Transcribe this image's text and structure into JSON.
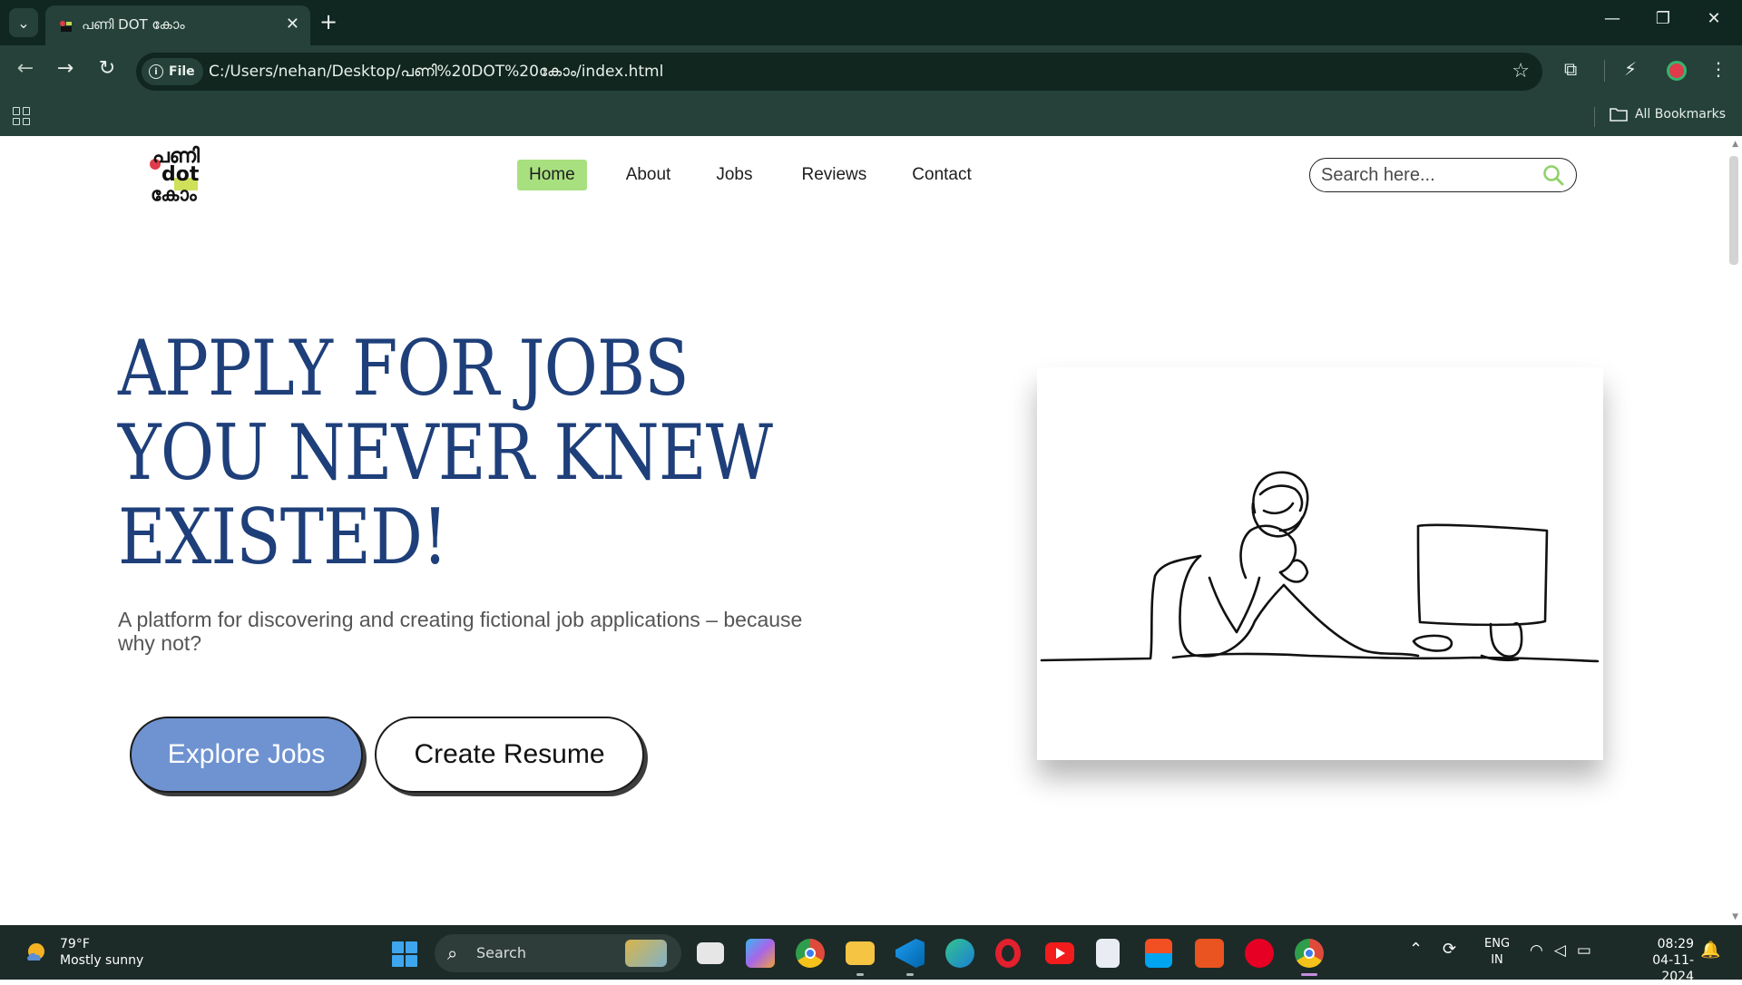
{
  "browser": {
    "tab_title": "പണി DOT കോം",
    "tab_close": "✕",
    "new_tab": "+",
    "window_controls": {
      "minimize": "—",
      "restore": "❐",
      "close": "✕"
    },
    "site_chip": "File",
    "url": "C:/Users/nehan/Desktop/പണി%20DOT%20കോം/index.html",
    "bookmarks_label": "All Bookmarks",
    "icons": [
      "tab-search-icon",
      "back-icon",
      "forward-icon",
      "reload-icon",
      "info-icon",
      "star-icon",
      "extensions-icon",
      "performance-icon",
      "profile-icon",
      "menu-icon",
      "apps-icon",
      "folder-icon"
    ]
  },
  "site": {
    "logo": {
      "line1": "പണി",
      "line2": "dot",
      "line3": "കോം"
    },
    "nav": [
      {
        "label": "Home",
        "active": true
      },
      {
        "label": "About",
        "active": false
      },
      {
        "label": "Jobs",
        "active": false
      },
      {
        "label": "Reviews",
        "active": false
      },
      {
        "label": "Contact",
        "active": false
      }
    ],
    "search_placeholder": "Search here...",
    "accent_color": "#a8e07f",
    "hero": {
      "heading_lines": [
        "APPLY FOR JOBS",
        "YOU NEVER KNEW",
        "EXISTED!"
      ],
      "subtitle": "A platform for discovering and creating fictional job applications – because why not?",
      "primary_button": "Explore Jobs",
      "secondary_button": "Create Resume",
      "heading_color": "#1e3f7a",
      "primary_button_color": "#6f93d1"
    }
  },
  "taskbar": {
    "weather_temp": "79°F",
    "weather_desc": "Mostly sunny",
    "search_label": "Search",
    "search_placeholder_glyph": "🔍",
    "apps": [
      "task-view",
      "copilot",
      "chrome",
      "file-explorer",
      "vscode",
      "edge",
      "opera",
      "youtube",
      "notepad",
      "microsoft-store",
      "ubuntu",
      "pinterest",
      "chrome-profile"
    ],
    "lang_line1": "ENG",
    "lang_line2": "IN",
    "time": "08:29",
    "date": "04-11-2024"
  }
}
